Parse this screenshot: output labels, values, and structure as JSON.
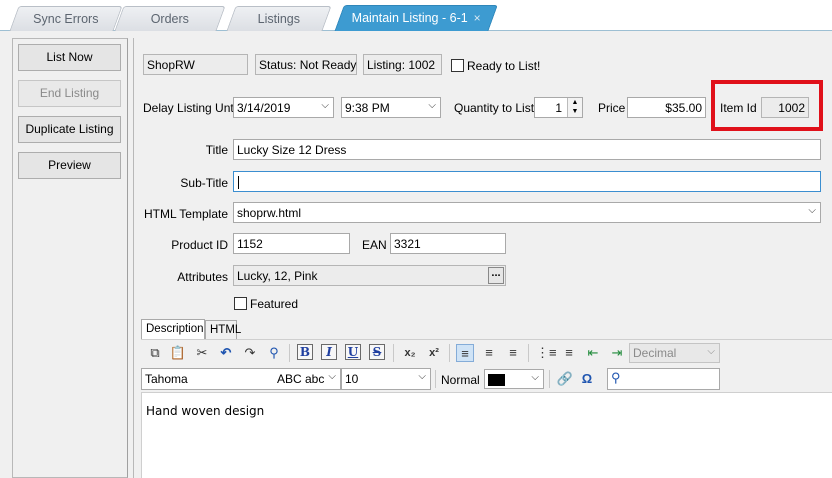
{
  "tabs": [
    {
      "label": "Sync Errors"
    },
    {
      "label": "Orders"
    },
    {
      "label": "Listings"
    },
    {
      "label": "Maintain Listing - 6-1",
      "close": "×"
    }
  ],
  "actions": {
    "list_now": "List Now",
    "end_listing": "End Listing",
    "duplicate_listing": "Duplicate Listing",
    "preview": "Preview"
  },
  "header": {
    "store": "ShopRW",
    "status": "Status: Not Ready",
    "listing": "Listing: 1002",
    "ready_label": "Ready to List!"
  },
  "schedule": {
    "delay_label": "Delay Listing Until",
    "date": "3/14/2019",
    "time": "9:38 PM",
    "quantity_label": "Quantity to List",
    "quantity": "1",
    "price_label": "Price",
    "price": "$35.00",
    "item_id_label": "Item Id",
    "item_id": "1002"
  },
  "form": {
    "title_label": "Title",
    "title": "Lucky Size 12 Dress",
    "subtitle_label": "Sub-Title",
    "subtitle": "",
    "template_label": "HTML Template",
    "template": "shoprw.html",
    "product_id_label": "Product ID",
    "product_id": "1152",
    "ean_label": "EAN",
    "ean": "3321",
    "attributes_label": "Attributes",
    "attributes": "Lucky, 12, Pink",
    "attributes_button": "...",
    "featured_label": "Featured"
  },
  "editor": {
    "tab_description": "Description",
    "tab_html": "HTML",
    "font": "Tahoma",
    "font_preview": "ABC abc",
    "size": "10",
    "style": "Normal",
    "list_format": "Decimal",
    "body": "Hand woven design"
  },
  "colors": {
    "accent": "#3d9bd1",
    "highlight": "#e0101a"
  }
}
